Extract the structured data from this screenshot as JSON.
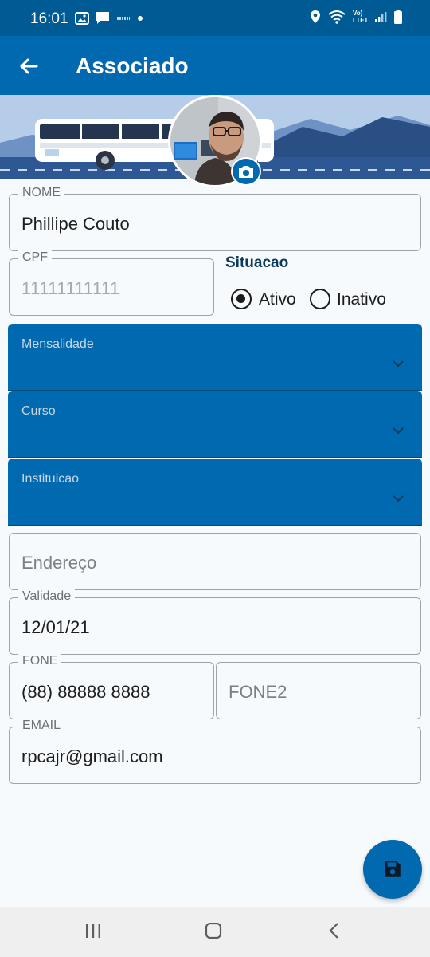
{
  "status_bar": {
    "time": "16:01",
    "network_label_top": "Vo)",
    "network_label_bottom": "LTE1"
  },
  "app_bar": {
    "title": "Associado"
  },
  "form": {
    "nome": {
      "label": "NOME",
      "value": "Phillipe Couto"
    },
    "cpf": {
      "label": "CPF",
      "hint": "11111111111"
    },
    "situacao": {
      "title": "Situacao",
      "options": [
        {
          "label": "Ativo",
          "selected": true
        },
        {
          "label": "Inativo",
          "selected": false
        }
      ]
    },
    "mensalidade": {
      "label": "Mensalidade"
    },
    "curso": {
      "label": "Curso"
    },
    "instituicao": {
      "label": "Instituicao"
    },
    "endereco": {
      "placeholder": "Endereço"
    },
    "validade": {
      "label": "Validade",
      "value": "12/01/21"
    },
    "fone": {
      "label": "FONE",
      "value": "(88) 88888 8888"
    },
    "fone2": {
      "placeholder": "FONE2"
    },
    "email": {
      "label": "EMAIL",
      "value": "rpcajr@gmail.com"
    }
  },
  "icons": {
    "back": "arrow-back-icon",
    "camera": "camera-icon",
    "save": "save-icon",
    "dropdown": "chevron-down-icon"
  },
  "colors": {
    "primary": "#0069b0",
    "status_bar": "#005a94",
    "background": "#f6fafd",
    "title_text": "#0b3a5c"
  }
}
